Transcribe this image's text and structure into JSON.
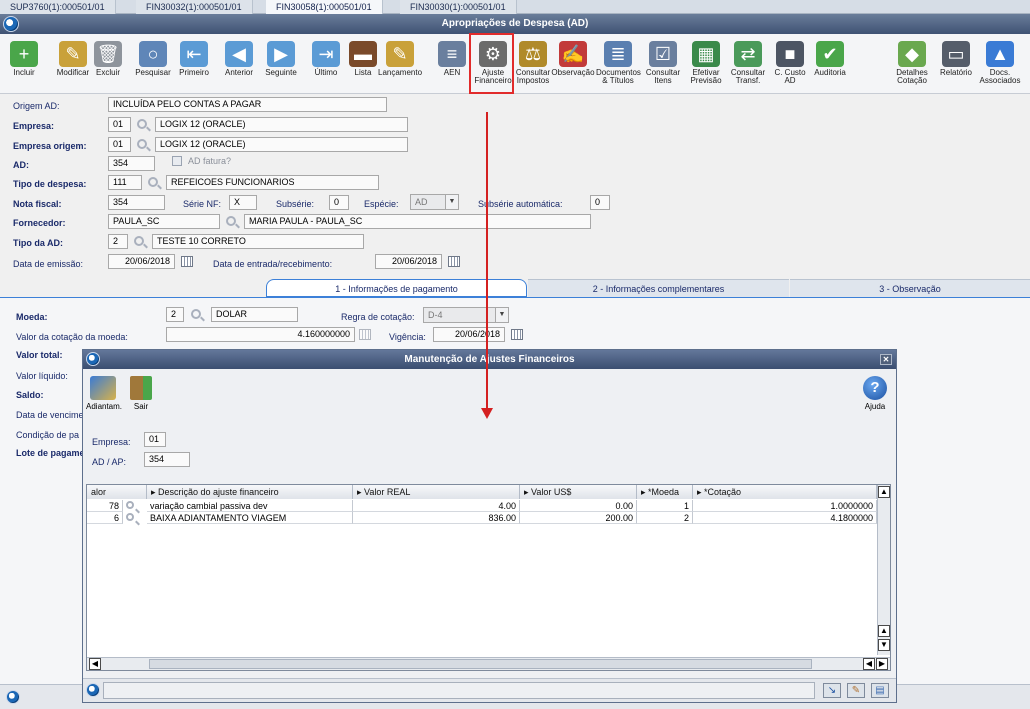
{
  "tabs": [
    "SUP3760(1):000501/01",
    "FIN30032(1):000501/01",
    "FIN30058(1):000501/01",
    "FIN30030(1):000501/01"
  ],
  "window_title": "Apropriações de Despesa (AD)",
  "toolbar": [
    {
      "label": "Incluir",
      "icon": "add-icon",
      "color": "#4aa64a"
    },
    {
      "label": "Modificar",
      "icon": "edit-icon",
      "color": "#c9a13a"
    },
    {
      "label": "Excluir",
      "icon": "trash-icon",
      "color": "#8e949c"
    },
    {
      "label": "Pesquisar",
      "icon": "magnifier-icon",
      "color": "#5f86b8"
    },
    {
      "label": "Primeiro",
      "icon": "first-icon",
      "color": "#5b9bd5"
    },
    {
      "label": "Anterior",
      "icon": "previous-icon",
      "color": "#5b9bd5"
    },
    {
      "label": "Seguinte",
      "icon": "next-icon",
      "color": "#5b9bd5"
    },
    {
      "label": "Último",
      "icon": "last-icon",
      "color": "#5b9bd5"
    },
    {
      "label": "Lista",
      "icon": "book-icon",
      "color": "#7a4a2a"
    },
    {
      "label": "Lançamento",
      "icon": "pen-icon",
      "color": "#c9a13a"
    },
    {
      "label": "AEN",
      "icon": "document-icon",
      "color": "#6a7f9e"
    },
    {
      "label": "Ajuste\nFinanceiro",
      "icon": "adjust-icon",
      "color": "#6b6b6b"
    },
    {
      "label": "Consultar\nImpostos",
      "icon": "scale-icon",
      "color": "#b08a2a"
    },
    {
      "label": "Observação",
      "icon": "note-icon",
      "color": "#c23a3a"
    },
    {
      "label": "Documentos\n& Títulos",
      "icon": "documents-icon",
      "color": "#5a7fb0"
    },
    {
      "label": "Consultar\nItens",
      "icon": "checklist-icon",
      "color": "#6a7f9e"
    },
    {
      "label": "Efetivar\nPrevisão",
      "icon": "calendar-icon",
      "color": "#3a8a4a"
    },
    {
      "label": "Consultar\nTransf.",
      "icon": "transfer-icon",
      "color": "#4a9a5a"
    },
    {
      "label": "C. Custo\nAD",
      "icon": "cube-icon",
      "color": "#4d5563"
    },
    {
      "label": "Auditoria",
      "icon": "audit-icon",
      "color": "#4aa64a"
    },
    {
      "label": "Detalhes\nCotação",
      "icon": "details-icon",
      "color": "#6aa84f"
    },
    {
      "label": "Relatório",
      "icon": "printer-icon",
      "color": "#555d6a"
    },
    {
      "label": "Docs.\nAssociados",
      "icon": "upload-icon",
      "color": "#3a7bd5"
    }
  ],
  "form": {
    "origem_label": "Origem AD:",
    "origem_value": "INCLUÍDA PELO CONTAS A PAGAR",
    "empresa_label": "Empresa:",
    "empresa_code": "01",
    "empresa_name": "LOGIX 12 (ORACLE)",
    "empresa_origem_label": "Empresa origem:",
    "empresa_origem_code": "01",
    "empresa_origem_name": "LOGIX 12 (ORACLE)",
    "ad_label": "AD:",
    "ad_value": "354",
    "ad_fatura_label": "AD fatura?",
    "tipo_despesa_label": "Tipo de despesa:",
    "tipo_despesa_code": "111",
    "tipo_despesa_name": "REFEICOES  FUNCIONARIOS",
    "nota_fiscal_label": "Nota fiscal:",
    "nota_fiscal_value": "354",
    "serie_label": "Série NF:",
    "serie_value": "X",
    "subserie_label": "Subsérie:",
    "subserie_value": "0",
    "especie_label": "Espécie:",
    "especie_value": "AD",
    "subserie_auto_label": "Subsérie automática:",
    "subserie_auto_value": "0",
    "fornecedor_label": "Fornecedor:",
    "fornecedor_code": "PAULA_SC",
    "fornecedor_name": "MARIA PAULA - PAULA_SC",
    "tipo_ad_label": "Tipo da AD:",
    "tipo_ad_code": "2",
    "tipo_ad_name": "TESTE 10 CORRETO",
    "data_emissao_label": "Data de emissão:",
    "data_emissao_value": "20/06/2018",
    "data_entrada_label": "Data de entrada/recebimento:",
    "data_entrada_value": "20/06/2018"
  },
  "subtabs": [
    "1 - Informações de pagamento",
    "2 - Informações complementares",
    "3 - Observação"
  ],
  "payment": {
    "moeda_label": "Moeda:",
    "moeda_code": "2",
    "moeda_name": "DOLAR",
    "regra_label": "Regra de cotação:",
    "regra_value": "D-4",
    "cotacao_label": "Valor da cotação da moeda:",
    "cotacao_value": "4.160000000",
    "vigencia_label": "Vigência:",
    "vigencia_value": "20/06/2018",
    "valor_total_label": "Valor total:",
    "valor_liquido_label": "Valor líquido:",
    "saldo_label": "Saldo:",
    "data_venc_label": "Data de vencime",
    "condicao_label": "Condição de pa",
    "lote_label": "Lote de pagame"
  },
  "dialog": {
    "title": "Manutenção de Ajustes Financeiros",
    "btn_adiantam": "Adiantam.",
    "btn_sair": "Sair",
    "btn_ajuda": "Ajuda",
    "empresa_label": "Empresa:",
    "empresa_value": "01",
    "adap_label": "AD / AP:",
    "adap_value": "354",
    "columns": [
      "alor",
      "Descrição do ajuste financeiro",
      "Valor REAL",
      "Valor US$",
      "*Moeda",
      "*Cotação"
    ],
    "rows": [
      [
        "78",
        "variação cambial passiva dev",
        "4.00",
        "0.00",
        "1",
        "1.0000000"
      ],
      [
        "6",
        "BAIXA ADIANTAMENTO VIAGEM",
        "836.00",
        "200.00",
        "2",
        "4.1800000"
      ]
    ]
  }
}
